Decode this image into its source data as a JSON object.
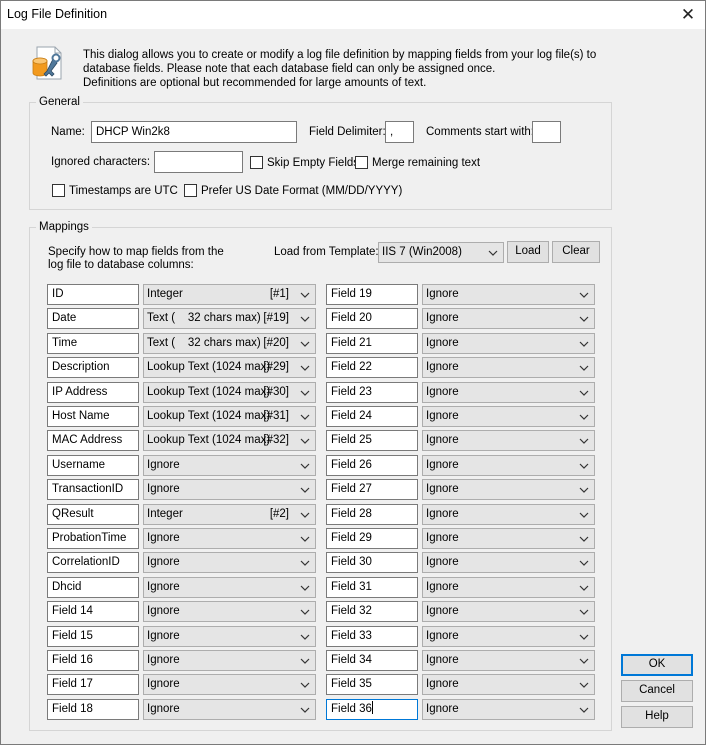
{
  "window": {
    "title": "Log File Definition",
    "close_glyph": "✕"
  },
  "intro": {
    "line1": "This dialog allows you to create or modify a log file definition by mapping fields from your log file(s) to",
    "line2": "database fields. Please note that each database field can only be assigned once.",
    "line3": "Definitions are optional but recommended for large amounts of text."
  },
  "general": {
    "label": "General",
    "name_label": "Name:",
    "name_value": "DHCP Win2k8",
    "delimiter_label": "Field Delimiter:",
    "delimiter_value": ",",
    "comments_label": "Comments start with:",
    "comments_value": "",
    "ignored_label": "Ignored characters:",
    "ignored_value": "",
    "skip_empty": {
      "label": "Skip Empty Fields",
      "checked": false
    },
    "merge_remaining": {
      "label": "Merge remaining text",
      "checked": false
    },
    "timestamps_utc": {
      "label": "Timestamps are UTC",
      "checked": false
    },
    "prefer_us_date": {
      "label": "Prefer US Date Format (MM/DD/YYYY)",
      "checked": false
    }
  },
  "mappings": {
    "label": "Mappings",
    "desc_line1": "Specify how to map fields from the",
    "desc_line2": "log file to database columns:",
    "template_label": "Load from Template:",
    "template_value": "IIS 7 (Win2008)",
    "load_button": "Load",
    "clear_button": "Clear",
    "left": [
      {
        "field": "ID",
        "type": "Integer",
        "tag": "[#1]"
      },
      {
        "field": "Date",
        "type": "Text (    32 chars max)",
        "tag": "[#19]"
      },
      {
        "field": "Time",
        "type": "Text (    32 chars max)",
        "tag": "[#20]"
      },
      {
        "field": "Description",
        "type": "Lookup Text (1024 max)",
        "tag": "[#29]"
      },
      {
        "field": "IP Address",
        "type": "Lookup Text (1024 max)",
        "tag": "[#30]"
      },
      {
        "field": "Host Name",
        "type": "Lookup Text (1024 max)",
        "tag": "[#31]"
      },
      {
        "field": "MAC Address",
        "type": "Lookup Text (1024 max)",
        "tag": "[#32]"
      },
      {
        "field": "Username",
        "type": "Ignore",
        "tag": ""
      },
      {
        "field": "TransactionID",
        "type": "Ignore",
        "tag": ""
      },
      {
        "field": "QResult",
        "type": "Integer",
        "tag": "[#2]"
      },
      {
        "field": "ProbationTime",
        "type": "Ignore",
        "tag": ""
      },
      {
        "field": "CorrelationID",
        "type": "Ignore",
        "tag": ""
      },
      {
        "field": "Dhcid",
        "type": "Ignore",
        "tag": ""
      },
      {
        "field": "Field 14",
        "type": "Ignore",
        "tag": ""
      },
      {
        "field": "Field 15",
        "type": "Ignore",
        "tag": ""
      },
      {
        "field": "Field 16",
        "type": "Ignore",
        "tag": ""
      },
      {
        "field": "Field 17",
        "type": "Ignore",
        "tag": ""
      },
      {
        "field": "Field 18",
        "type": "Ignore",
        "tag": ""
      }
    ],
    "right": [
      {
        "field": "Field 19",
        "type": "Ignore",
        "tag": ""
      },
      {
        "field": "Field 20",
        "type": "Ignore",
        "tag": ""
      },
      {
        "field": "Field 21",
        "type": "Ignore",
        "tag": ""
      },
      {
        "field": "Field 22",
        "type": "Ignore",
        "tag": ""
      },
      {
        "field": "Field 23",
        "type": "Ignore",
        "tag": ""
      },
      {
        "field": "Field 24",
        "type": "Ignore",
        "tag": ""
      },
      {
        "field": "Field 25",
        "type": "Ignore",
        "tag": ""
      },
      {
        "field": "Field 26",
        "type": "Ignore",
        "tag": ""
      },
      {
        "field": "Field 27",
        "type": "Ignore",
        "tag": ""
      },
      {
        "field": "Field 28",
        "type": "Ignore",
        "tag": ""
      },
      {
        "field": "Field 29",
        "type": "Ignore",
        "tag": ""
      },
      {
        "field": "Field 30",
        "type": "Ignore",
        "tag": ""
      },
      {
        "field": "Field 31",
        "type": "Ignore",
        "tag": ""
      },
      {
        "field": "Field 32",
        "type": "Ignore",
        "tag": ""
      },
      {
        "field": "Field 33",
        "type": "Ignore",
        "tag": ""
      },
      {
        "field": "Field 34",
        "type": "Ignore",
        "tag": ""
      },
      {
        "field": "Field 35",
        "type": "Ignore",
        "tag": ""
      },
      {
        "field": "Field 36",
        "type": "Ignore",
        "tag": ""
      }
    ]
  },
  "buttons": {
    "ok": "OK",
    "cancel": "Cancel",
    "help": "Help"
  },
  "colors": {
    "accent": "#0078d7",
    "window_bg": "#f0f0f0",
    "combo_bg": "#e5e5e5"
  },
  "icons": {
    "dialog_icon": "database-wrench-icon",
    "dropdown": "chevron-down-icon",
    "close": "close-icon"
  }
}
